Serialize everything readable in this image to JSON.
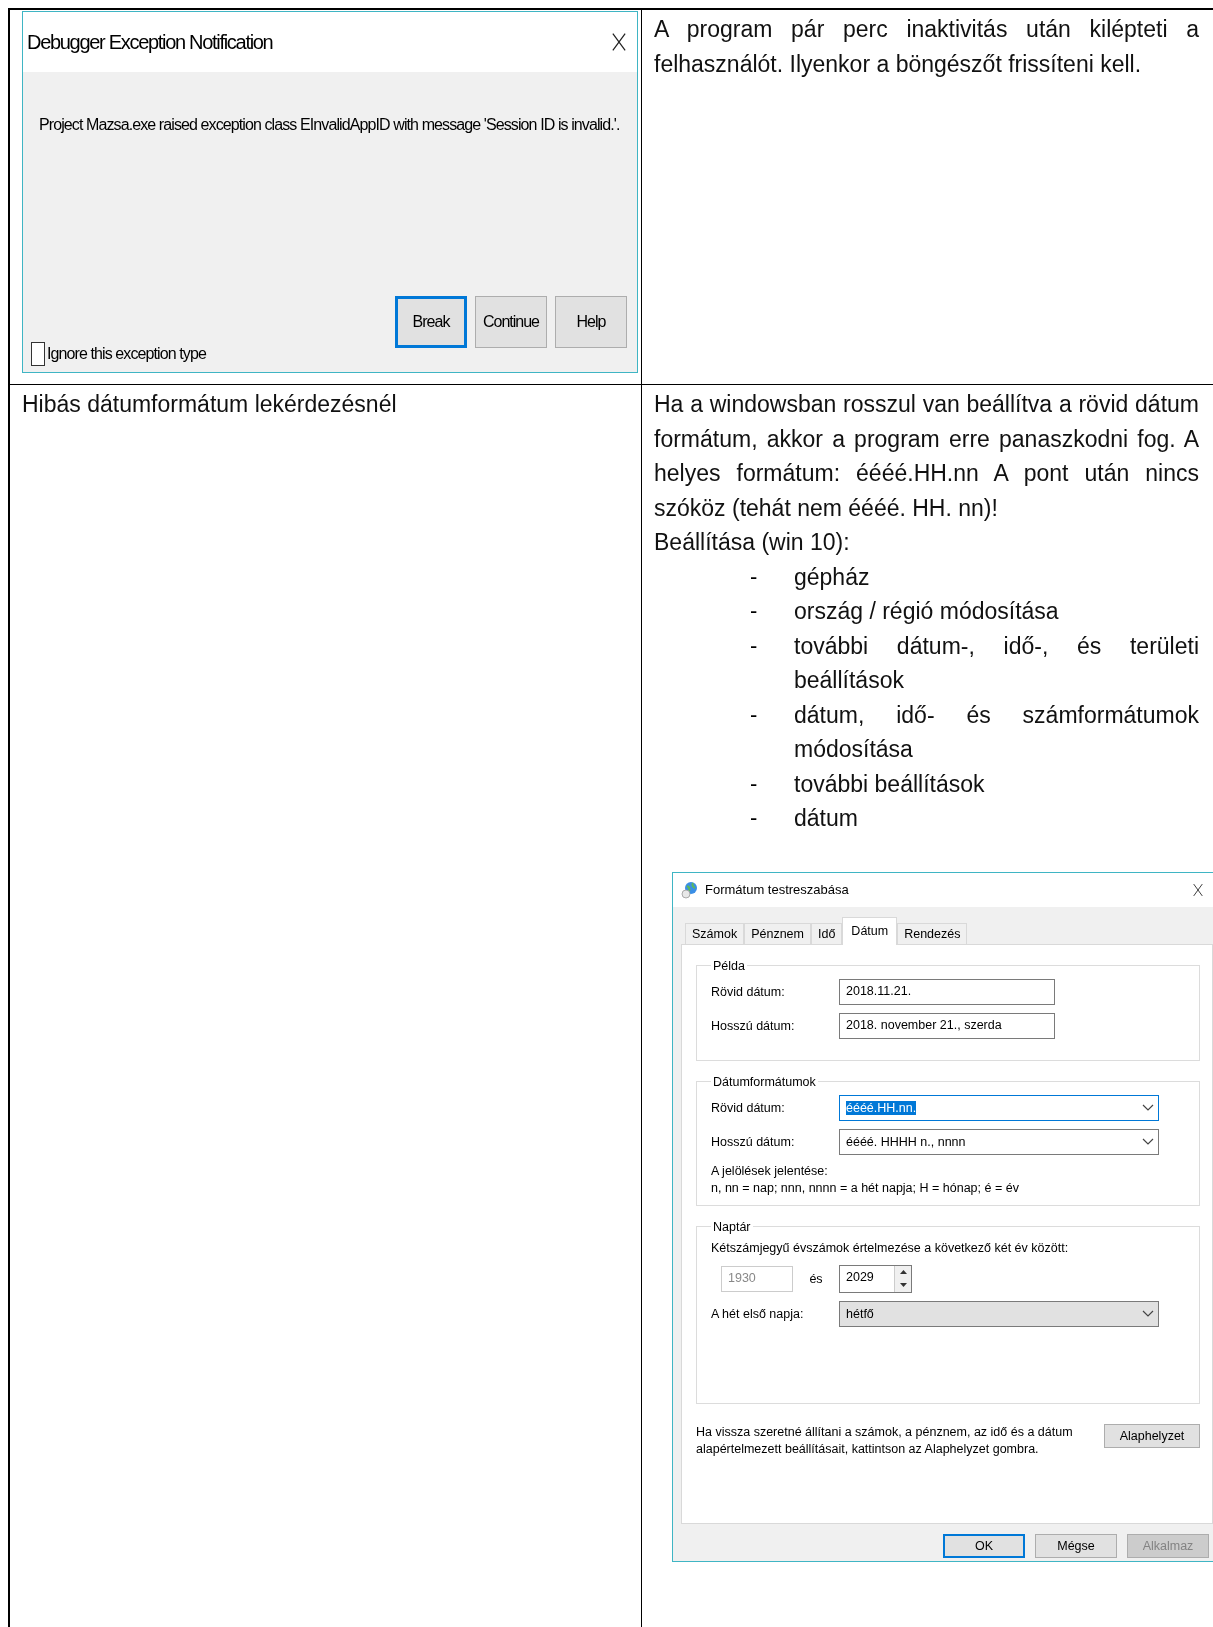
{
  "rows": [
    {
      "cell_1": {
        "dialog": {
          "title": "Debugger Exception Notification",
          "message": "Project Mazsa.exe raised exception class EInvalidAppID with message 'Session ID is invalid.'.",
          "buttons": [
            {
              "label": "Break",
              "default": true
            },
            {
              "label": "Continue",
              "default": false
            },
            {
              "label": "Help",
              "default": false
            }
          ],
          "checkbox": {
            "label": "Ignore this exception type",
            "checked": false
          }
        }
      },
      "cell_2": {
        "text": "A program pár perc inaktivitás után kilépteti a felhasználót. Ilyenkor a böngészőt frissíteni kell."
      }
    },
    {
      "cell_1": {
        "text": "Hibás dátumformátum lekérdezésnél"
      },
      "cell_2": {
        "text": "Ha a windowsban rosszul van beállítva a rövid dátum formátum, akkor a program erre panaszkodni fog. A helyes formátum: éééé.HH.nn A pont után nincs szóköz (tehát nem éééé. HH. nn)!",
        "subheading": "Beállítása (win 10):",
        "steps": [
          {
            "bullet": "-",
            "text": "gépház"
          },
          {
            "bullet": "-",
            "text": "ország / régió módosítása"
          },
          {
            "bullet": "-",
            "text": "további dátum-, idő-, és területi beállítások"
          },
          {
            "bullet": "-",
            "text": "dátum, idő- és számformátumok módosítása"
          },
          {
            "bullet": "-",
            "text": "további beállítások"
          },
          {
            "bullet": "-",
            "text": "dátum"
          }
        ],
        "dialog": {
          "title": "Formátum testreszabása",
          "tabs": [
            {
              "label": "Számok",
              "selected": false
            },
            {
              "label": "Pénznem",
              "selected": false
            },
            {
              "label": "Idő",
              "selected": false
            },
            {
              "label": "Dátum",
              "selected": true
            },
            {
              "label": "Rendezés",
              "selected": false
            }
          ],
          "example_group": {
            "title": "Példa",
            "fields": [
              {
                "label": "Rövid dátum:",
                "value": "2018.11.21."
              },
              {
                "label": "Hosszú dátum:",
                "value": "2018. november 21., szerda"
              }
            ]
          },
          "formats_group": {
            "title": "Dátumformátumok",
            "fields": [
              {
                "label": "Rövid dátum:",
                "value": "éééé.HH.nn.",
                "highlighted": true
              },
              {
                "label": "Hosszú dátum:",
                "value": "éééé. HHHH n., nnnn",
                "highlighted": false
              }
            ],
            "legend_title": "A jelölések jelentése:",
            "legend": "n, nn = nap; nnn, nnnn = a hét napja; H = hónap; é = év"
          },
          "calendar_group": {
            "title": "Naptár",
            "prompt": "Kétszámjegyű évszámok értelmezése a következő két év között:",
            "range_from": {
              "value": "1930",
              "disabled": true
            },
            "range_separator": "és",
            "range_to": "2029",
            "first_day_label": "A hét első napja:",
            "first_day": "hétfő"
          },
          "reset_note": "Ha vissza szeretné állítani a számok, a pénznem, az idő és a dátum alapértelmezett beállításait, kattintson az Alaphelyzet gombra.",
          "reset_button": "Alaphelyzet",
          "buttons": [
            {
              "label": "OK",
              "default": true,
              "disabled": false
            },
            {
              "label": "Mégse",
              "default": false,
              "disabled": false
            },
            {
              "label": "Alkalmaz",
              "default": false,
              "disabled": true
            }
          ]
        }
      }
    }
  ]
}
